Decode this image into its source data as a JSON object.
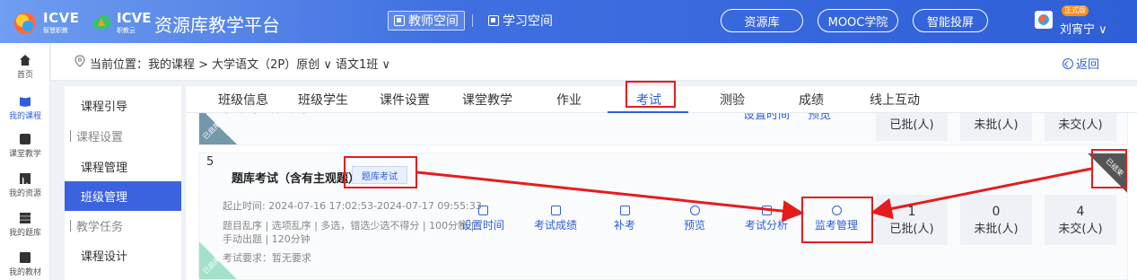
{
  "header": {
    "logo_icve_1": "ICVE",
    "logo_icve_1_sub": "智慧职教",
    "logo_icve_2": "ICVE",
    "logo_icve_2_sub": "职教云",
    "platform_title": "资源库教学平台",
    "space_tabs": [
      "教师空间",
      "学习空间"
    ],
    "pills": [
      "资源库",
      "MOOC学院",
      "智能投屏"
    ],
    "badge": "正式版",
    "user": "刘宵宁"
  },
  "sidebar": {
    "items": [
      {
        "label": "首页",
        "icon": "home-icon"
      },
      {
        "label": "我的课程",
        "icon": "course-icon"
      },
      {
        "label": "课堂教学",
        "icon": "classroom-icon"
      },
      {
        "label": "我的资源",
        "icon": "resource-icon"
      },
      {
        "label": "我的题库",
        "icon": "question-bank-icon"
      },
      {
        "label": "我的教材",
        "icon": "textbook-icon"
      }
    ]
  },
  "breadcrumb": {
    "text": "当前位置：我的课程 > 大学语文（2P）原创 ∨ 语文1班 ∨",
    "back": "返回"
  },
  "submenu": {
    "items": [
      "课程引导",
      "课程设置",
      "课程管理",
      "班级管理",
      "教学任务",
      "课程设计"
    ]
  },
  "tabs": [
    "班级信息",
    "班级学生",
    "课件设置",
    "课堂教学",
    "作业",
    "考试",
    "测验",
    "成绩",
    "线上互动"
  ],
  "prev_card": {
    "truncated_text": "考试要求：暂无要求",
    "links": [
      "设置时间",
      "预览"
    ],
    "stats": [
      "已批(人)",
      "未批(人)",
      "未交(人)"
    ],
    "stamp": "已启用"
  },
  "exam": {
    "number": "5",
    "title": "题库考试（含有主观题）",
    "type": "题库考试",
    "time": "起止时间: 2024-07-16 17:02:53-2024-07-17 09:55:33",
    "meta1": "题目乱序 | 选项乱序 | 多选，错选少选不得分 | 100分制 |",
    "meta2": "手动出题 | 120分钟",
    "requirement": "考试要求：暂无要求",
    "stamp": "已启用",
    "corner": "已结束",
    "actions": [
      "设置时间",
      "考试成绩",
      "补考",
      "预览",
      "考试分析",
      "监考管理"
    ],
    "stats": [
      {
        "count": "1",
        "label": "已批(人)"
      },
      {
        "count": "0",
        "label": "未批(人)"
      },
      {
        "count": "4",
        "label": "未交(人)"
      }
    ]
  },
  "colors": {
    "accent": "#2f5fd8",
    "highlight": "#e61c1c",
    "header_start": "#6f9df0",
    "header_end": "#2f5fd8"
  }
}
